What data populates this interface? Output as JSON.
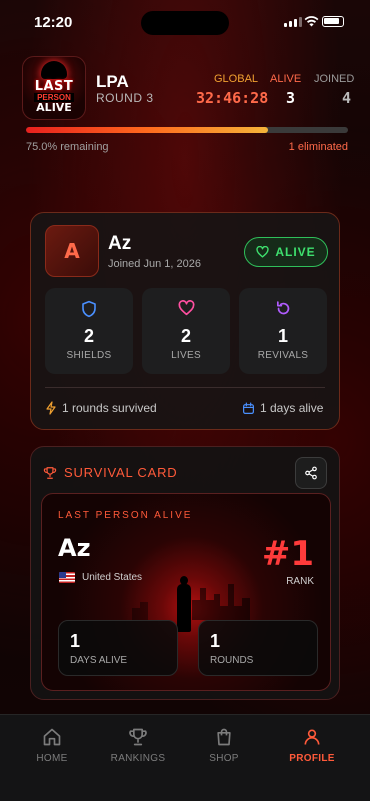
{
  "status_bar": {
    "time": "12:20"
  },
  "header": {
    "logo": {
      "line1": "LAST",
      "line2": "PERSON",
      "line3": "ALIVE"
    },
    "title": "LPA",
    "round": "ROUND 3",
    "stats": {
      "global_label": "GLOBAL",
      "global_value": "32:46:28",
      "alive_label": "ALIVE",
      "alive_value": "3",
      "joined_label": "JOINED",
      "joined_value": "4"
    },
    "progress": {
      "fill_percent": 75,
      "remaining_text": "75.0% remaining",
      "eliminated_text": "1 eliminated"
    }
  },
  "profile": {
    "avatar_letter": "A",
    "name": "Az",
    "joined": "Joined Jun 1, 2026",
    "status": "ALIVE",
    "tiles": [
      {
        "icon": "shield-icon",
        "value": "2",
        "label": "SHIELDS"
      },
      {
        "icon": "heart-icon",
        "value": "2",
        "label": "LIVES"
      },
      {
        "icon": "revive-icon",
        "value": "1",
        "label": "REVIVALS"
      }
    ],
    "rounds_survived": "1 rounds survived",
    "days_alive": "1 days alive"
  },
  "survival_card": {
    "title": "SURVIVAL CARD",
    "header": "LAST PERSON ALIVE",
    "name": "Az",
    "country": "United States",
    "rank": "#1",
    "rank_label": "RANK",
    "days_alive_value": "1",
    "days_alive_label": "DAYS ALIVE",
    "rounds_value": "1",
    "rounds_label": "ROUNDS"
  },
  "nav": {
    "items": [
      {
        "label": "HOME",
        "icon": "home-icon"
      },
      {
        "label": "RANKINGS",
        "icon": "trophy-icon"
      },
      {
        "label": "SHOP",
        "icon": "shopping-bag-icon"
      },
      {
        "label": "PROFILE",
        "icon": "user-icon"
      }
    ],
    "active": "PROFILE"
  },
  "colors": {
    "accent": "#ff5a3a",
    "alive": "#3ee06e",
    "gold": "#f0a030",
    "background": "#120404"
  }
}
